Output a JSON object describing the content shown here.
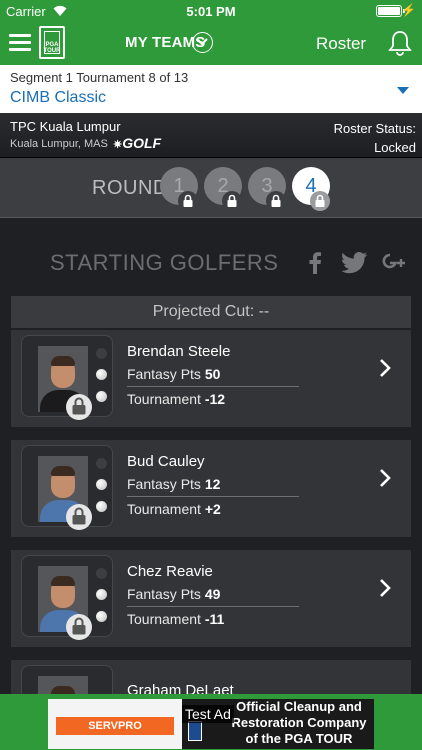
{
  "status_bar": {
    "carrier": "Carrier",
    "time": "5:01 PM",
    "bolt": "⚡"
  },
  "navbar": {
    "logo_text": "PGA TOUR",
    "my_teams": "MY TEAMS",
    "roster": "Roster"
  },
  "tournament": {
    "segment_info": "Segment 1 Tournament 8 of 13",
    "name": "CIMB Classic"
  },
  "course": {
    "name": "TPC Kuala Lumpur",
    "location": "Kuala Lumpur, MAS",
    "broadcaster": "GOLF",
    "roster_status_label": "Roster Status:",
    "roster_status_value": "Locked"
  },
  "rounds": {
    "label": "ROUND",
    "items": [
      "1",
      "2",
      "3",
      "4"
    ],
    "active": "4"
  },
  "section": {
    "title": "STARTING GOLFERS"
  },
  "projected_cut": "Projected Cut: --",
  "golfers": [
    {
      "name": "Brendan Steele",
      "fantasy_label": "Fantasy Pts",
      "fantasy_pts": "50",
      "tournament_label": "Tournament",
      "tournament_score": "-12"
    },
    {
      "name": "Bud Cauley",
      "fantasy_label": "Fantasy Pts",
      "fantasy_pts": "12",
      "tournament_label": "Tournament",
      "tournament_score": "+2"
    },
    {
      "name": "Chez Reavie",
      "fantasy_label": "Fantasy Pts",
      "fantasy_pts": "49",
      "tournament_label": "Tournament",
      "tournament_score": "-11"
    },
    {
      "name": "Graham DeLaet"
    }
  ],
  "ad": {
    "label": "Test Ad",
    "sponsor": "SERVPRO",
    "text_line1": "Official Cleanup and",
    "text_line2": "Restoration Company",
    "text_line3": "of the PGA TOUR"
  },
  "colors": {
    "brand_green": "#2f9a3a",
    "link_blue": "#1a6fb5",
    "servpro_orange": "#f26722"
  },
  "icons": [
    "wifi-icon",
    "battery-icon",
    "hamburger-icon",
    "chevron-down-icon",
    "bell-icon",
    "lock-icon",
    "facebook-icon",
    "twitter-icon",
    "google-plus-icon",
    "chevron-right-icon",
    "golf-ball-icon"
  ]
}
